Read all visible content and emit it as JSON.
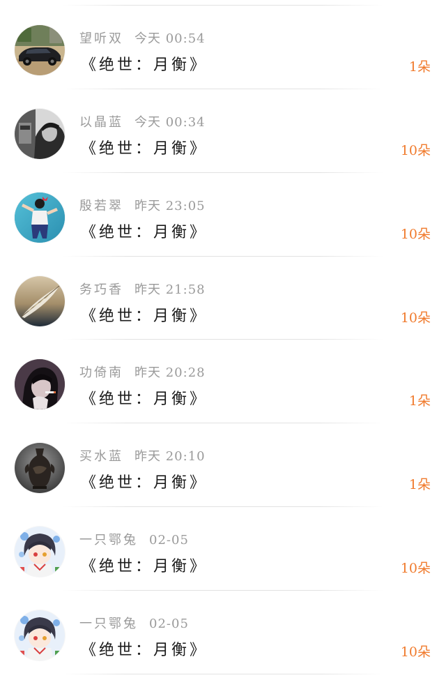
{
  "accent_color": "#f07a2c",
  "meta_color": "#9a9a9a",
  "title_color": "#1b1b1b",
  "items": [
    {
      "user": "望听双",
      "time": "今天 00:54",
      "title": "《绝世：月衡》",
      "count": "1朵",
      "avatar_icon": "avatar-car-icon"
    },
    {
      "user": "以晶蓝",
      "time": "今天 00:34",
      "title": "《绝世：月衡》",
      "count": "10朵",
      "avatar_icon": "avatar-person-icon"
    },
    {
      "user": "殷若翠",
      "time": "昨天 23:05",
      "title": "《绝世：月衡》",
      "count": "10朵",
      "avatar_icon": "avatar-girl-wall-icon"
    },
    {
      "user": "务巧香",
      "time": "昨天 21:58",
      "title": "《绝世：月衡》",
      "count": "10朵",
      "avatar_icon": "avatar-feather-icon"
    },
    {
      "user": "功倚南",
      "time": "昨天 20:28",
      "title": "《绝世：月衡》",
      "count": "1朵",
      "avatar_icon": "avatar-smoking-icon"
    },
    {
      "user": "买水蓝",
      "time": "昨天 20:10",
      "title": "《绝世：月衡》",
      "count": "1朵",
      "avatar_icon": "avatar-vase-icon"
    },
    {
      "user": "一只鄂兔",
      "time": "02-05",
      "title": "《绝世：月衡》",
      "count": "10朵",
      "avatar_icon": "avatar-anime-icon"
    },
    {
      "user": "一只鄂兔",
      "time": "02-05",
      "title": "《绝世：月衡》",
      "count": "10朵",
      "avatar_icon": "avatar-anime-icon"
    }
  ]
}
